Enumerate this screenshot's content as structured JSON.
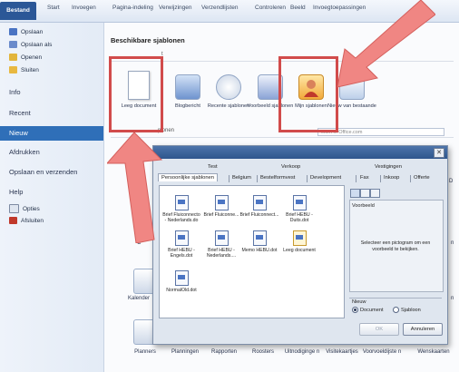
{
  "ribbon": {
    "file_tab": "Bestand",
    "tabs": [
      "Start",
      "Invoegen",
      "Pagina-indeling",
      "Verwijzingen",
      "Verzendlijsten",
      "Controleren",
      "Beeld",
      "Invoegtoepassingen"
    ]
  },
  "nav": {
    "small_items": [
      "Opslaan",
      "Opslaan als",
      "Openen",
      "Sluiten"
    ],
    "info": "Info",
    "recent": "Recent",
    "new": "Nieuw",
    "print": "Afdrukken",
    "save_send": "Opslaan en verzenden",
    "help": "Help",
    "options": "Opties",
    "exit": "Afsluiten"
  },
  "main": {
    "section_title": "Beschikbare sjablonen",
    "crumb": "t",
    "tiles": [
      {
        "label": "Leeg document",
        "icon": "blank-document-icon"
      },
      {
        "label": "Blogbericht",
        "icon": "blog-post-icon"
      },
      {
        "label": "Recente sjablonen",
        "icon": "recent-templates-icon"
      },
      {
        "label": "Voorbeeld sjablonen",
        "icon": "sample-templates-icon"
      },
      {
        "label": "Mijn sjablonen",
        "icon": "my-templates-icon"
      },
      {
        "label": "Nieuw van bestaande",
        "icon": "new-from-existing-icon"
      }
    ],
    "cat_title": "plonen",
    "office_search": "eken in Office.com",
    "side_labels": [
      "A",
      "C",
      "Kalender",
      "D",
      "n",
      "n"
    ],
    "bottom_row": [
      "Planners",
      "Planningen",
      "Rapporten",
      "Roosters",
      "Uitnodiginge n",
      "Visitekaartjes",
      "Voorvoeldijste n",
      "Wenskaarten"
    ]
  },
  "dialog": {
    "tabs_top": [
      "Test",
      "Verkoop",
      "Vestigingen"
    ],
    "tabs_bottom": [
      "Persoonlijke sjablonen",
      "Belgium",
      "Bestelformvest",
      "Development",
      "Fax",
      "Inkoop",
      "Offerte"
    ],
    "templates": [
      "Brief Fluiconnecto - Nederlands.do",
      "Brief Fluiconne...",
      "Brief Fluiconnect...",
      "Brief HEBU - Duits.dot",
      "Brief HEBU - Engels.dot",
      "Brief HEBU - Nederlands....",
      "Memo HEBU.dot",
      "Leeg document",
      "NormalOld.dot"
    ],
    "preview_label": "Voorbeeld",
    "preview_hint": "Selecteer een pictogram om een voorbeeld te bekijken.",
    "new_label": "Nieuw",
    "radio_document": "Document",
    "radio_template": "Sjabloon",
    "ok": "OK",
    "cancel": "Annuleren"
  },
  "colors": {
    "highlight": "#d14b4b",
    "file_tab": "#2b5797",
    "nav_selected": "#2f6fb8"
  }
}
